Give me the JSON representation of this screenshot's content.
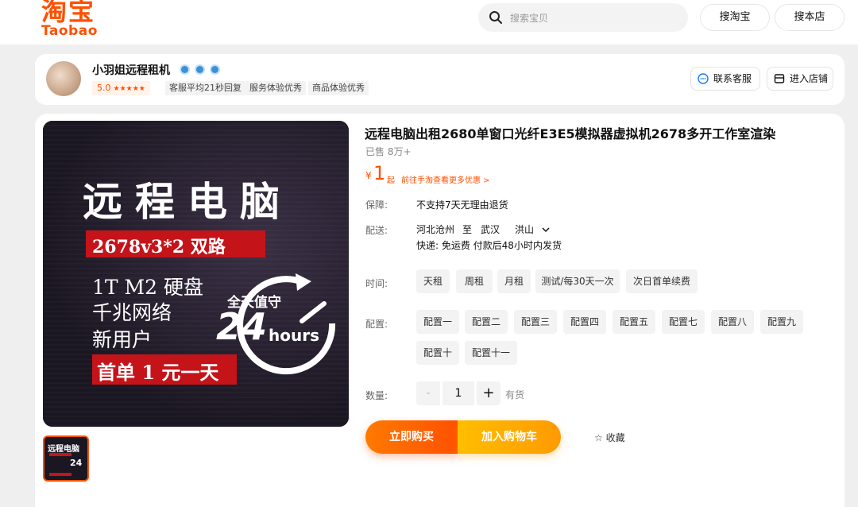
{
  "header": {
    "logo_cn": "淘宝",
    "logo_en": "Taobao",
    "search_placeholder": "搜索宝贝",
    "search_taobao": "搜淘宝",
    "search_store": "搜本店"
  },
  "shop": {
    "name": "小羽姐远程租机",
    "rating": "5.0",
    "stars": "★★★★★",
    "tags": [
      "客服平均21秒回复",
      "服务体验优秀",
      "商品体验优秀"
    ],
    "contact": "联系客服",
    "enter_store": "进入店铺"
  },
  "product": {
    "title": "远程电脑出租2680单窗口光纤E3E5模拟器虚拟机2678多开工作室渲染",
    "sold": "已售 8万+",
    "price_symbol": "¥",
    "price": "1",
    "price_suffix": "起",
    "promo": "前往手淘查看更多优惠 >",
    "guarantee_label": "保障:",
    "guarantee": "不支持7天无理由退货",
    "shipping_label": "配送:",
    "ship_from": "河北沧州",
    "ship_to_word": "至",
    "ship_city": "武汉",
    "ship_district": "洪山",
    "ship_info": "快递: 免运费  付款后48小时内发货",
    "time_label": "时间:",
    "time_options": [
      "天租",
      "周租",
      "月租",
      "测试/每30天一次",
      "次日首单续费"
    ],
    "config_label": "配置:",
    "config_options": [
      "配置一",
      "配置二",
      "配置三",
      "配置四",
      "配置五",
      "配置七",
      "配置八",
      "配置九",
      "配置十",
      "配置十一"
    ],
    "qty_label": "数量:",
    "qty_minus": "-",
    "qty": "1",
    "qty_plus": "+",
    "stock": "有货",
    "buy_now": "立即购买",
    "add_cart": "加入购物车",
    "favorite": "☆ 收藏"
  },
  "hero_image": {
    "headline": "远程电脑",
    "spec": "2678v3*2 双路",
    "line1": "1T M2 硬盘",
    "line2": "千兆网络",
    "line3": "新用户",
    "offer": "首单 1 元一天",
    "clock_caption": "全天值守",
    "clock_num": "24",
    "clock_unit": "hours"
  }
}
